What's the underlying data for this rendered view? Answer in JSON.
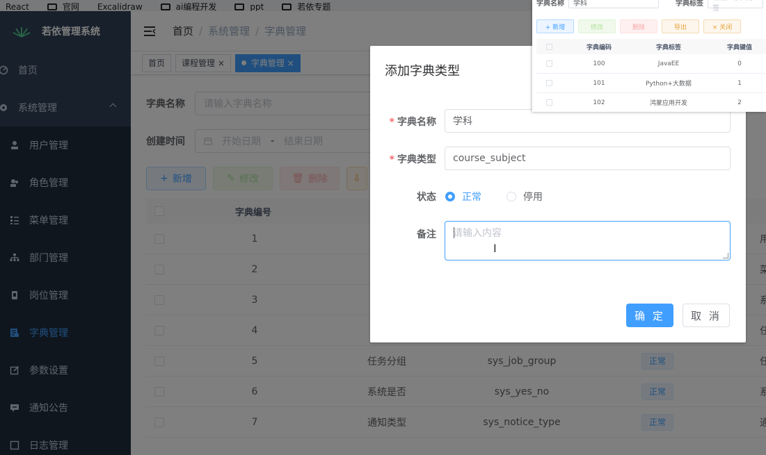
{
  "bookmarks": [
    "React",
    "官网",
    "Excalidraw",
    "ai编程开发",
    "ppt",
    "若依专题"
  ],
  "sidebar": {
    "app_title": "若依管理系统",
    "home": "首页",
    "system": "系统管理",
    "items": [
      {
        "label": "用户管理",
        "icon": "user-icon"
      },
      {
        "label": "角色管理",
        "icon": "role-icon"
      },
      {
        "label": "菜单管理",
        "icon": "menu-list-icon"
      },
      {
        "label": "部门管理",
        "icon": "dept-tree-icon"
      },
      {
        "label": "岗位管理",
        "icon": "post-icon"
      },
      {
        "label": "字典管理",
        "icon": "dict-icon",
        "active": true
      },
      {
        "label": "参数设置",
        "icon": "edit-icon"
      },
      {
        "label": "通知公告",
        "icon": "message-icon"
      },
      {
        "label": "日志管理",
        "icon": "log-icon"
      }
    ]
  },
  "breadcrumb": [
    "首页",
    "系统管理",
    "字典管理"
  ],
  "tags": [
    {
      "label": "首页"
    },
    {
      "label": "课程管理 ×"
    },
    {
      "label": "字典管理 ×",
      "active": true
    }
  ],
  "filters": {
    "dict_name_label": "字典名称",
    "dict_name_placeholder": "请输入字典名称",
    "created_label": "创建时间",
    "start_date": "开始日期",
    "date_sep": "-",
    "end_date": "结束日期"
  },
  "toolbar": {
    "add": "新增",
    "edit": "修改",
    "delete": "删除"
  },
  "table": {
    "col_id": "字典编号",
    "rows": [
      {
        "id": "1",
        "name": "",
        "type": "",
        "status": ""
      },
      {
        "id": "2",
        "name": "",
        "type": "",
        "status": ""
      },
      {
        "id": "3",
        "name": "",
        "type": "",
        "status": ""
      },
      {
        "id": "4",
        "name": "",
        "type": "",
        "status": ""
      },
      {
        "id": "5",
        "name": "任务分组",
        "type": "sys_job_group",
        "status": "正常"
      },
      {
        "id": "6",
        "name": "系统是否",
        "type": "sys_yes_no",
        "status": "正常"
      },
      {
        "id": "7",
        "name": "通知类型",
        "type": "sys_notice_type",
        "status": "正常"
      }
    ],
    "right_col": [
      "用",
      "菜",
      "系",
      "任",
      "任",
      "系",
      "通"
    ]
  },
  "dialog": {
    "title": "添加字典类型",
    "name_label": "字典名称",
    "name_value": "学科",
    "type_label": "字典类型",
    "type_value": "course_subject",
    "status_label": "状态",
    "status_normal": "正常",
    "status_disabled": "停用",
    "remark_label": "备注",
    "remark_placeholder": "请输入内容",
    "ok": "确 定",
    "cancel": "取 消"
  },
  "thumbnail": {
    "filter_label": "字典名称",
    "filter_value": "学科",
    "label2": "字典标签",
    "placeholder2": "请输入字典标签",
    "buttons": [
      "+ 新增",
      "修改",
      "删除",
      "导出",
      "× 关闭"
    ],
    "headers": [
      "字典编码",
      "字典标签",
      "字典键值"
    ],
    "rows": [
      {
        "code": "100",
        "label": "JavaEE",
        "value": "0"
      },
      {
        "code": "101",
        "label": "Python+大数据",
        "value": "1"
      },
      {
        "code": "102",
        "label": "鸿蒙应用开发",
        "value": "2"
      }
    ]
  },
  "colors": {
    "primary": "#409eff",
    "sidebar": "#304156",
    "danger": "#f56c6c",
    "warning": "#e6a23c",
    "success": "#67c23a"
  }
}
